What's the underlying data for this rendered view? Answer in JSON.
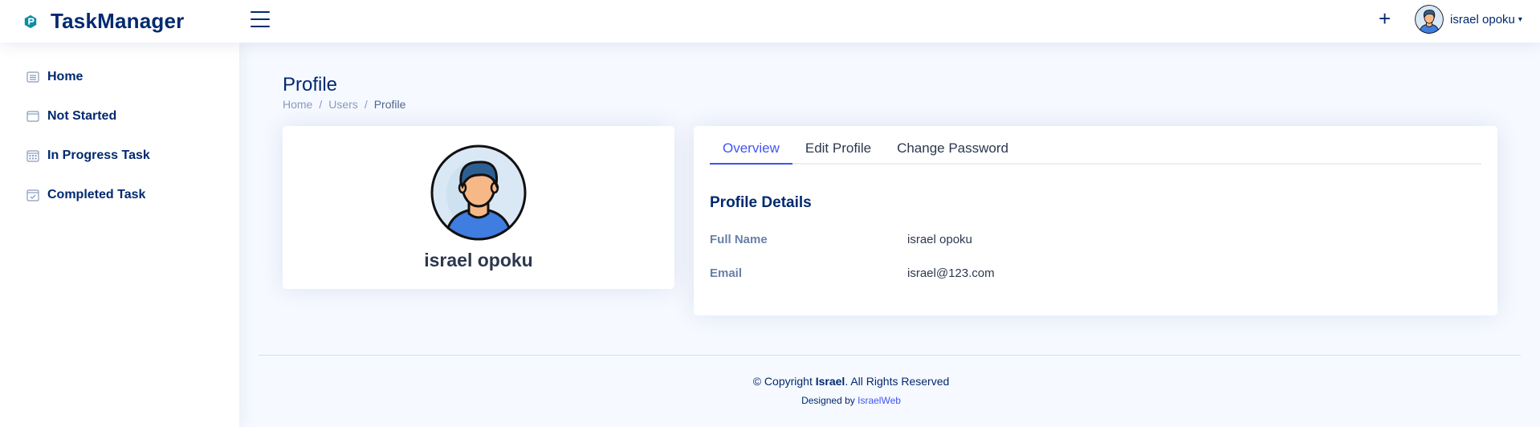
{
  "header": {
    "brand": "TaskManager",
    "plus_label": "+",
    "user_name": "israel opoku",
    "caret": "▾"
  },
  "sidebar": {
    "items": [
      {
        "label": "Home",
        "icon": "list-icon"
      },
      {
        "label": "Not Started",
        "icon": "window-icon"
      },
      {
        "label": "In Progress Task",
        "icon": "calendar-grid-icon"
      },
      {
        "label": "Completed Task",
        "icon": "calendar-check-icon"
      }
    ]
  },
  "page": {
    "title": "Profile",
    "breadcrumb": [
      "Home",
      "Users",
      "Profile"
    ],
    "separator": "/"
  },
  "profile_card": {
    "name": "israel opoku"
  },
  "details_card": {
    "tabs": [
      "Overview",
      "Edit Profile",
      "Change Password"
    ],
    "active_tab": "Overview",
    "section_title": "Profile Details",
    "rows": [
      {
        "label": "Full Name",
        "value": "israel opoku"
      },
      {
        "label": "Email",
        "value": "israel@123.com"
      }
    ]
  },
  "footer": {
    "copy_prefix": "© Copyright ",
    "copy_brand": "Israel",
    "copy_suffix": ". All Rights Reserved",
    "designed_prefix": "Designed by ",
    "designed_link": "IsraelWeb"
  },
  "colors": {
    "primary": "#012970",
    "accent": "#4154f1",
    "background": "#f6f9ff",
    "logo": "#0d8ea3"
  }
}
